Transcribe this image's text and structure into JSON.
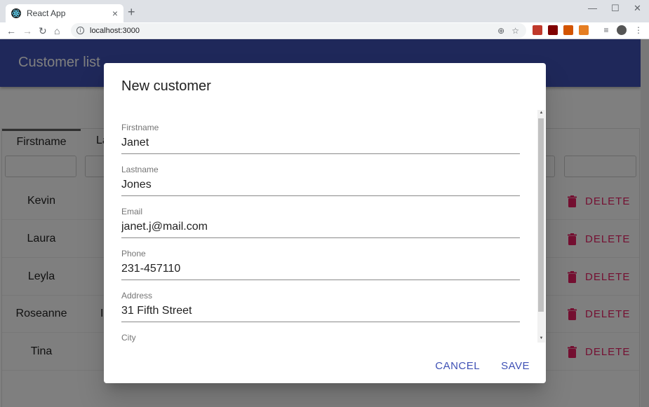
{
  "browser": {
    "tab_title": "React App",
    "tab_close": "×",
    "new_tab": "+",
    "url": "localhost:3000",
    "minimize": "—",
    "maximize": "☐",
    "close": "✕"
  },
  "app": {
    "title": "Customer list"
  },
  "table": {
    "columns": [
      "Firstname",
      "La"
    ],
    "rows": [
      {
        "firstname": "Kevin",
        "lastname": ""
      },
      {
        "firstname": "Laura",
        "lastname": ""
      },
      {
        "firstname": "Leyla",
        "lastname": ""
      },
      {
        "firstname": "Roseanne",
        "lastname": "I"
      },
      {
        "firstname": "Tina",
        "lastname": ""
      }
    ],
    "delete_label": "DELETE"
  },
  "dialog": {
    "title": "New customer",
    "fields": [
      {
        "label": "Firstname",
        "value": "Janet"
      },
      {
        "label": "Lastname",
        "value": "Jones"
      },
      {
        "label": "Email",
        "value": "janet.j@mail.com"
      },
      {
        "label": "Phone",
        "value": "231-457110"
      },
      {
        "label": "Address",
        "value": "31 Fifth Street"
      },
      {
        "label": "City",
        "value": ""
      }
    ],
    "cancel_label": "CANCEL",
    "save_label": "SAVE"
  },
  "colors": {
    "primary": "#3f51b5",
    "secondary": "#e91e63"
  },
  "icons": {
    "tab_favicon": "react-logo-icon",
    "delete_icon": "trash-can-icon"
  }
}
